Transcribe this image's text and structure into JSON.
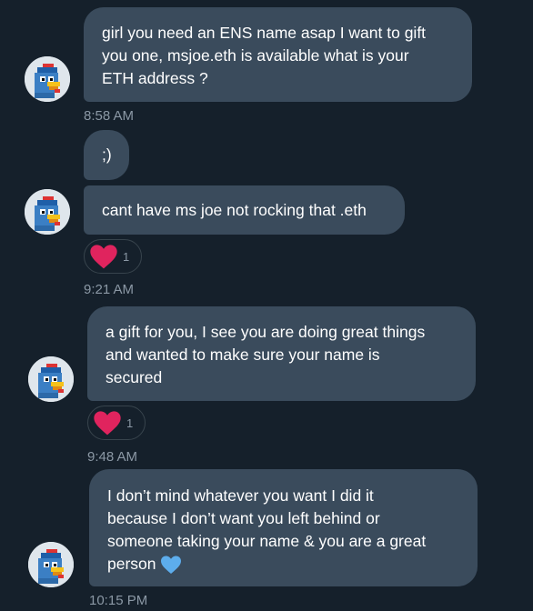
{
  "colors": {
    "background": "#15202b",
    "bubble": "#3a4b5c",
    "timestamp": "#8b98a5",
    "heart_red": "#e0245e",
    "heart_blue": "#5dadec"
  },
  "messages": [
    {
      "text": "girl you need an ENS name asap I want to gift\nyou one, msjoe.eth is available what is your\nETH address ?"
    },
    {
      "text": ";)"
    },
    {
      "text": "cant have ms joe not rocking that .eth",
      "reaction": {
        "icon": "red-heart-icon",
        "count": "1"
      }
    },
    {
      "text": "a gift for you, I see you are doing great things\nand wanted to make sure your name is\nsecured",
      "reaction": {
        "icon": "red-heart-icon",
        "count": "1"
      }
    },
    {
      "text": "I don’t mind whatever you want I did it\nbecause I don’t want you left behind or\nsomeone taking your name & you are a great\nperson",
      "trailing_emoji": "blue-heart-icon"
    }
  ],
  "timestamps": [
    "8:58 AM",
    "9:21 AM",
    "9:48 AM",
    "10:15 PM"
  ],
  "avatar_icon": "blue-bird-avatar-icon"
}
